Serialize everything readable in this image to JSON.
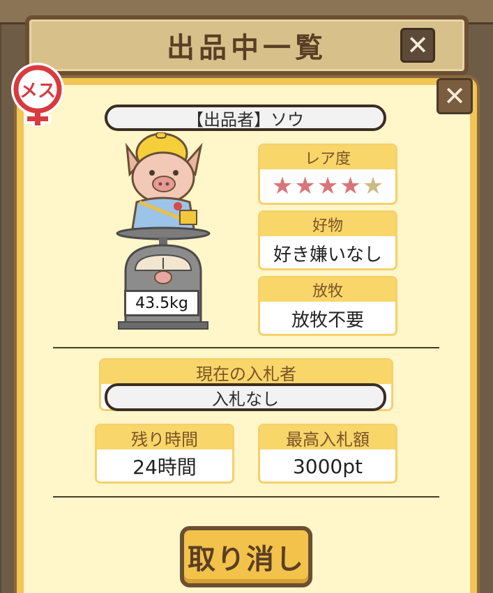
{
  "header": {
    "title": "出品中一覧"
  },
  "gender_badge": {
    "label": "メス"
  },
  "listing": {
    "seller": "【出品者】ソウ",
    "weight": "43.5kg",
    "rarity": {
      "label": "レア度",
      "stars": 4,
      "max_stars": 5
    },
    "favorite_food": {
      "label": "好物",
      "value": "好き嫌いなし"
    },
    "grazing": {
      "label": "放牧",
      "value": "放牧不要"
    },
    "current_bidder": {
      "label": "現在の入札者",
      "value": "入札なし"
    },
    "remaining_time": {
      "label": "残り時間",
      "value": "24時間"
    },
    "max_bid": {
      "label": "最高入札額",
      "value": "3000pt"
    }
  },
  "actions": {
    "cancel_label": "取り消し"
  },
  "colors": {
    "star_filled": "#d9757a",
    "star_empty": "#cdbb86",
    "accent": "#f9d66a"
  }
}
